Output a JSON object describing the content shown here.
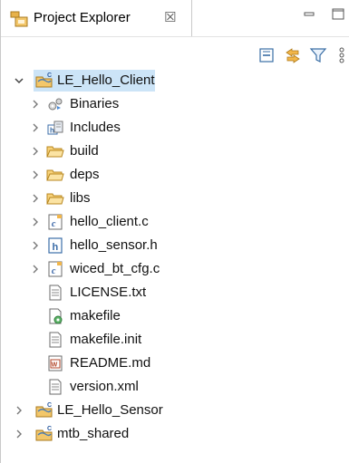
{
  "tab": {
    "title": "Project Explorer",
    "close_glyph": "☒"
  },
  "toolbar": {
    "buttons": [
      "collapse-all-icon",
      "link-with-editor-icon",
      "filter-icon",
      "view-menu-icon"
    ]
  },
  "tree": {
    "items": [
      {
        "label": "LE_Hello_Client",
        "type": "project",
        "expanded": true,
        "selected": true
      },
      {
        "label": "Binaries",
        "type": "binaries"
      },
      {
        "label": "Includes",
        "type": "includes"
      },
      {
        "label": "build",
        "type": "folder"
      },
      {
        "label": "deps",
        "type": "folder"
      },
      {
        "label": "libs",
        "type": "folder"
      },
      {
        "label": "hello_client.c",
        "type": "c-file"
      },
      {
        "label": "hello_sensor.h",
        "type": "h-file"
      },
      {
        "label": "wiced_bt_cfg.c",
        "type": "c-file"
      },
      {
        "label": "LICENSE.txt",
        "type": "text-file"
      },
      {
        "label": "makefile",
        "type": "makefile"
      },
      {
        "label": "makefile.init",
        "type": "text-file"
      },
      {
        "label": "README.md",
        "type": "markdown-file"
      },
      {
        "label": "version.xml",
        "type": "text-file"
      },
      {
        "label": "LE_Hello_Sensor",
        "type": "project"
      },
      {
        "label": "mtb_shared",
        "type": "project"
      }
    ]
  }
}
